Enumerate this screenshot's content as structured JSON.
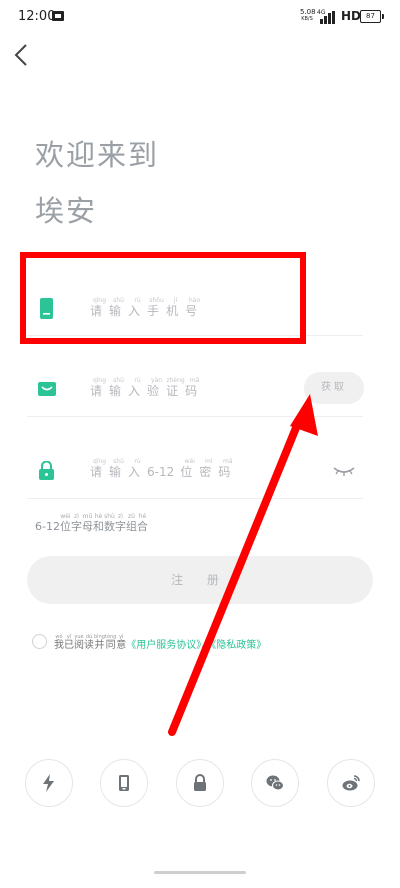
{
  "status_bar": {
    "time": "12:00",
    "speed_value": "5.08",
    "speed_unit": "KB/S",
    "network": "4G",
    "hd": "HD",
    "battery": "87"
  },
  "welcome": {
    "line1": "欢迎来到",
    "line2": "埃安"
  },
  "phone_input": {
    "placeholder_chars": [
      {
        "char": "请",
        "pinyin": "qǐng"
      },
      {
        "char": "输",
        "pinyin": "shū"
      },
      {
        "char": "入",
        "pinyin": "rù"
      },
      {
        "char": "手",
        "pinyin": "shǒu"
      },
      {
        "char": "机",
        "pinyin": "jī"
      },
      {
        "char": "号",
        "pinyin": "hào"
      }
    ]
  },
  "code_input": {
    "placeholder_chars": [
      {
        "char": "请",
        "pinyin": "qǐng"
      },
      {
        "char": "输",
        "pinyin": "shū"
      },
      {
        "char": "入",
        "pinyin": "rù"
      },
      {
        "char": "验",
        "pinyin": "yàn"
      },
      {
        "char": "证",
        "pinyin": "zhèng"
      },
      {
        "char": "码",
        "pinyin": "mǎ"
      }
    ],
    "get_code_label": "获取"
  },
  "password_input": {
    "placeholder_prefix": [
      {
        "char": "请",
        "pinyin": "qǐng"
      },
      {
        "char": "输",
        "pinyin": "shū"
      },
      {
        "char": "入",
        "pinyin": "rù"
      }
    ],
    "placeholder_range": "6-12",
    "placeholder_suffix": [
      {
        "char": "位",
        "pinyin": "wèi"
      },
      {
        "char": "密",
        "pinyin": "mì"
      },
      {
        "char": "码",
        "pinyin": "mǎ"
      }
    ]
  },
  "password_hint": {
    "range": "6-12",
    "chars": [
      {
        "char": "位",
        "pinyin": "wèi"
      },
      {
        "char": "字",
        "pinyin": "zì"
      },
      {
        "char": "母",
        "pinyin": "mǔ"
      },
      {
        "char": "和",
        "pinyin": "hé"
      },
      {
        "char": "数",
        "pinyin": "shù"
      },
      {
        "char": "字",
        "pinyin": "zì"
      },
      {
        "char": "组",
        "pinyin": "zǔ"
      },
      {
        "char": "合",
        "pinyin": "hé"
      }
    ]
  },
  "register_button": {
    "label": "注 册"
  },
  "agreement": {
    "prefix_chars": [
      {
        "char": "我",
        "pinyin": "wǒ"
      },
      {
        "char": "已",
        "pinyin": "yǐ"
      },
      {
        "char": "阅",
        "pinyin": "yuè"
      },
      {
        "char": "读",
        "pinyin": "dú"
      },
      {
        "char": "并",
        "pinyin": "bìng"
      },
      {
        "char": "同",
        "pinyin": "tóng"
      },
      {
        "char": "意",
        "pinyin": "yì"
      }
    ],
    "user_agreement": "《用户服务协议》",
    "separator": "、",
    "privacy_policy": "《隐私政策》"
  },
  "colors": {
    "accent": "#2cc397",
    "placeholder": "#b5b8bd",
    "annotation": "#ff0000"
  },
  "bottom_icons": [
    "flash-icon",
    "phone-icon",
    "lock-icon",
    "wechat-icon",
    "weibo-icon"
  ]
}
